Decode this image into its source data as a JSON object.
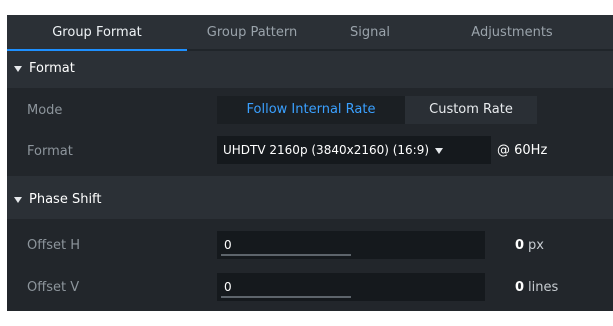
{
  "tabs": [
    {
      "label": "Group Format",
      "active": true
    },
    {
      "label": "Group Pattern",
      "active": false
    },
    {
      "label": "Signal",
      "active": false
    },
    {
      "label": "Adjustments",
      "active": false
    }
  ],
  "format_section": {
    "title": "Format",
    "mode": {
      "label": "Mode",
      "options": [
        {
          "label": "Follow Internal Rate",
          "selected": true
        },
        {
          "label": "Custom Rate",
          "selected": false
        }
      ]
    },
    "format": {
      "label": "Format",
      "selected": "UHDTV 2160p (3840x2160) (16:9)",
      "frequency": "@ 60Hz"
    }
  },
  "phase_section": {
    "title": "Phase Shift",
    "offset_h": {
      "label": "Offset H",
      "value": "0",
      "readout": "0",
      "unit": "px"
    },
    "offset_v": {
      "label": "Offset V",
      "value": "0",
      "readout": "0",
      "unit": "lines"
    }
  },
  "colors": {
    "accent": "#3aa0ff",
    "tab_indicator": "#1e90ff",
    "panel_bg": "#22262b",
    "header_bg": "#2b3036",
    "field_bg": "#15191d"
  }
}
